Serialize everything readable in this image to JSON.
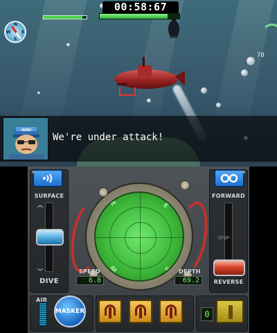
{
  "hud": {
    "timer": "00:58:67",
    "player_health": 0.85,
    "enemy_health": 0.9,
    "compass_letters": [
      "N",
      "E",
      "S",
      "W"
    ],
    "depth_readout": "70"
  },
  "dialog": {
    "speaker_badge": "AOKI",
    "message": "We're under attack!"
  },
  "controls": {
    "left_button_icon": "sonar-ping-icon",
    "right_button_icon": "binoculars-icon",
    "surface_label": "SURFACE",
    "dive_label": "DIVE",
    "forward_label": "FORWARD",
    "reverse_label": "REVERSE",
    "stop_label": "STOP",
    "speed_label": "SPEED",
    "speed_value": "6.8",
    "depth_label": "DEPTH",
    "depth_value": "69.2",
    "radar_dirs": [
      "N",
      "E",
      "S",
      "W"
    ],
    "air_label": "AIR",
    "masker_label": "MASKER",
    "weapon_slots": [
      "weapon-1",
      "weapon-2",
      "weapon-3"
    ],
    "special_count": "0"
  },
  "colors": {
    "accent_blue": "#1e6fd0",
    "radar_green": "#3fb93c",
    "warning_red": "#c6302c",
    "weapon_gold": "#e0a82a"
  }
}
